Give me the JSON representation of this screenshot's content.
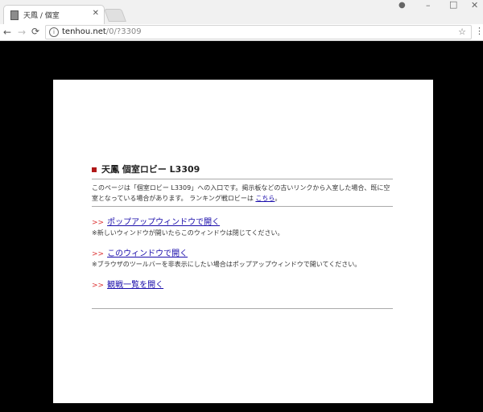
{
  "browser": {
    "tab": {
      "title": "天鳳 / 個室",
      "close": "✕"
    },
    "address": {
      "host": "tenhou.net",
      "path": "/0/?3309"
    },
    "icons": [
      "favicon-icon",
      "close-icon",
      "profile-icon",
      "minimize-icon",
      "maximize-icon",
      "window-close-icon",
      "back-icon",
      "forward-icon",
      "reload-icon",
      "info-icon",
      "star-icon",
      "menu-icon"
    ]
  },
  "page": {
    "heading": "天鳳 個室ロビー L3309",
    "intro_text": "このページは「個室ロビー L3309」への入口です。掲示板などの古いリンクから入室した場合、既に空室となっている場合があります。 ランキング戦ロビーは",
    "intro_link": "こちら",
    "intro_end": "。",
    "arrows": ">>",
    "actions": [
      {
        "label": "ポップアップウィンドウで開く",
        "note": "※新しいウィンドウが開いたらこのウィンドウは閉じてください。"
      },
      {
        "label": "このウィンドウで開く",
        "note": "※ブラウザのツールバーを非表示にしたい場合はポップアップウィンドウで開いてください。"
      },
      {
        "label": "観戦一覧を開く",
        "note": ""
      }
    ]
  },
  "colors": {
    "marker": "#b01818",
    "link": "#1a0dab",
    "arrows": "#dd3333",
    "background": "#000000"
  }
}
